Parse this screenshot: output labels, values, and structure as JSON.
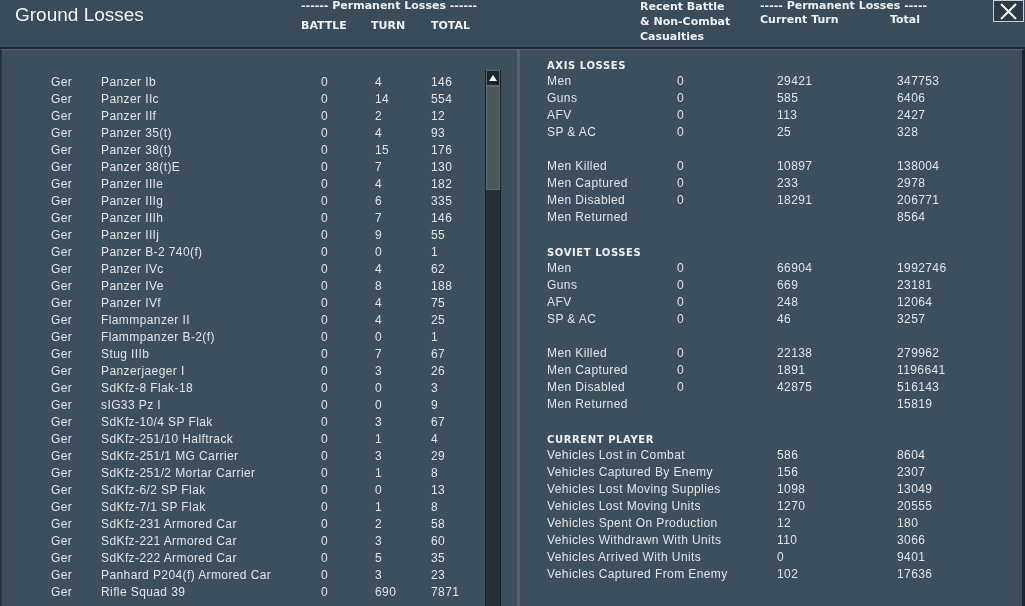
{
  "window": {
    "title": "Ground Losses"
  },
  "units_header": {
    "group_label": "------ Permanent Losses ------",
    "columns": [
      "BATTLE",
      "TURN",
      "TOTAL"
    ]
  },
  "summary_header": {
    "recent_label": "Recent Battle\n& Non-Combat\nCasualties",
    "group_label": "----- Permanent Losses -----",
    "columns": [
      "Current Turn",
      "Total"
    ]
  },
  "units_table": {
    "rows": [
      {
        "nation": "Ger",
        "unit": "Panzer Ib",
        "battle": "0",
        "turn": "4",
        "total": "146"
      },
      {
        "nation": "Ger",
        "unit": "Panzer IIc",
        "battle": "0",
        "turn": "14",
        "total": "554"
      },
      {
        "nation": "Ger",
        "unit": "Panzer IIf",
        "battle": "0",
        "turn": "2",
        "total": "12"
      },
      {
        "nation": "Ger",
        "unit": "Panzer 35(t)",
        "battle": "0",
        "turn": "4",
        "total": "93"
      },
      {
        "nation": "Ger",
        "unit": "Panzer 38(t)",
        "battle": "0",
        "turn": "15",
        "total": "176"
      },
      {
        "nation": "Ger",
        "unit": "Panzer 38(t)E",
        "battle": "0",
        "turn": "7",
        "total": "130"
      },
      {
        "nation": "Ger",
        "unit": "Panzer IIIe",
        "battle": "0",
        "turn": "4",
        "total": "182"
      },
      {
        "nation": "Ger",
        "unit": "Panzer IIIg",
        "battle": "0",
        "turn": "6",
        "total": "335"
      },
      {
        "nation": "Ger",
        "unit": "Panzer IIIh",
        "battle": "0",
        "turn": "7",
        "total": "146"
      },
      {
        "nation": "Ger",
        "unit": "Panzer IIIj",
        "battle": "0",
        "turn": "9",
        "total": "55"
      },
      {
        "nation": "Ger",
        "unit": "Panzer B-2 740(f)",
        "battle": "0",
        "turn": "0",
        "total": "1"
      },
      {
        "nation": "Ger",
        "unit": "Panzer IVc",
        "battle": "0",
        "turn": "4",
        "total": "62"
      },
      {
        "nation": "Ger",
        "unit": "Panzer IVe",
        "battle": "0",
        "turn": "8",
        "total": "188"
      },
      {
        "nation": "Ger",
        "unit": "Panzer IVf",
        "battle": "0",
        "turn": "4",
        "total": "75"
      },
      {
        "nation": "Ger",
        "unit": "Flammpanzer II",
        "battle": "0",
        "turn": "4",
        "total": "25"
      },
      {
        "nation": "Ger",
        "unit": "Flammpanzer B-2(f)",
        "battle": "0",
        "turn": "0",
        "total": "1"
      },
      {
        "nation": "Ger",
        "unit": "Stug IIIb",
        "battle": "0",
        "turn": "7",
        "total": "67"
      },
      {
        "nation": "Ger",
        "unit": "Panzerjaeger I",
        "battle": "0",
        "turn": "3",
        "total": "26"
      },
      {
        "nation": "Ger",
        "unit": "SdKfz-8 Flak-18",
        "battle": "0",
        "turn": "0",
        "total": "3"
      },
      {
        "nation": "Ger",
        "unit": "sIG33 Pz I",
        "battle": "0",
        "turn": "0",
        "total": "9"
      },
      {
        "nation": "Ger",
        "unit": "SdKfz-10/4 SP Flak",
        "battle": "0",
        "turn": "3",
        "total": "67"
      },
      {
        "nation": "Ger",
        "unit": "SdKfz-251/10 Halftrack",
        "battle": "0",
        "turn": "1",
        "total": "4"
      },
      {
        "nation": "Ger",
        "unit": "SdKfz-251/1 MG Carrier",
        "battle": "0",
        "turn": "3",
        "total": "29"
      },
      {
        "nation": "Ger",
        "unit": "SdKfz-251/2 Mortar Carrier",
        "battle": "0",
        "turn": "1",
        "total": "8"
      },
      {
        "nation": "Ger",
        "unit": "SdKfz-6/2 SP Flak",
        "battle": "0",
        "turn": "0",
        "total": "13"
      },
      {
        "nation": "Ger",
        "unit": "SdKfz-7/1 SP Flak",
        "battle": "0",
        "turn": "1",
        "total": "8"
      },
      {
        "nation": "Ger",
        "unit": "SdKfz-231 Armored Car",
        "battle": "0",
        "turn": "2",
        "total": "58"
      },
      {
        "nation": "Ger",
        "unit": "SdKfz-221 Armored Car",
        "battle": "0",
        "turn": "3",
        "total": "60"
      },
      {
        "nation": "Ger",
        "unit": "SdKfz-222 Armored Car",
        "battle": "0",
        "turn": "5",
        "total": "35"
      },
      {
        "nation": "Ger",
        "unit": "Panhard P204(f) Armored Car",
        "battle": "0",
        "turn": "3",
        "total": "23"
      },
      {
        "nation": "Ger",
        "unit": "Rifle Squad 39",
        "battle": "0",
        "turn": "690",
        "total": "7871"
      }
    ]
  },
  "summary": {
    "sections": [
      {
        "heading": "AXIS LOSSES",
        "groups": [
          [
            {
              "label": "Men",
              "recent": "0",
              "turn": "29421",
              "total": "347753"
            },
            {
              "label": "Guns",
              "recent": "0",
              "turn": "585",
              "total": "6406"
            },
            {
              "label": "AFV",
              "recent": "0",
              "turn": "113",
              "total": "2427"
            },
            {
              "label": "SP & AC",
              "recent": "0",
              "turn": "25",
              "total": "328"
            }
          ],
          [
            {
              "label": "Men Killed",
              "recent": "0",
              "turn": "10897",
              "total": "138004"
            },
            {
              "label": "Men Captured",
              "recent": "0",
              "turn": "233",
              "total": "2978"
            },
            {
              "label": "Men Disabled",
              "recent": "0",
              "turn": "18291",
              "total": "206771"
            },
            {
              "label": "Men Returned",
              "total": "8564"
            }
          ]
        ]
      },
      {
        "heading": "SOVIET LOSSES",
        "groups": [
          [
            {
              "label": "Men",
              "recent": "0",
              "turn": "66904",
              "total": "1992746"
            },
            {
              "label": "Guns",
              "recent": "0",
              "turn": "669",
              "total": "23181"
            },
            {
              "label": "AFV",
              "recent": "0",
              "turn": "248",
              "total": "12064"
            },
            {
              "label": "SP & AC",
              "recent": "0",
              "turn": "46",
              "total": "3257"
            }
          ],
          [
            {
              "label": "Men Killed",
              "recent": "0",
              "turn": "22138",
              "total": "279962"
            },
            {
              "label": "Men Captured",
              "recent": "0",
              "turn": "1891",
              "total": "1196641"
            },
            {
              "label": "Men Disabled",
              "recent": "0",
              "turn": "42875",
              "total": "516143"
            },
            {
              "label": "Men Returned",
              "total": "15819"
            }
          ]
        ]
      },
      {
        "heading": "CURRENT PLAYER",
        "groups": [
          [
            {
              "label": "Vehicles Lost in Combat",
              "turn": "586",
              "total": "8604"
            },
            {
              "label": "Vehicles Captured By Enemy",
              "turn": "156",
              "total": "2307"
            },
            {
              "label": "Vehicles Lost Moving Supplies",
              "turn": "1098",
              "total": "13049"
            },
            {
              "label": "Vehicles Lost Moving Units",
              "turn": "1270",
              "total": "20555"
            },
            {
              "label": "Vehicles Spent On Production",
              "turn": "12",
              "total": "180"
            },
            {
              "label": "Vehicles Withdrawn With Units",
              "turn": "110",
              "total": "3066"
            },
            {
              "label": "Vehicles Arrived With Units",
              "turn": "0",
              "total": "9401"
            },
            {
              "label": "Vehicles Captured From Enemy",
              "turn": "102",
              "total": "17636"
            }
          ]
        ]
      }
    ]
  }
}
